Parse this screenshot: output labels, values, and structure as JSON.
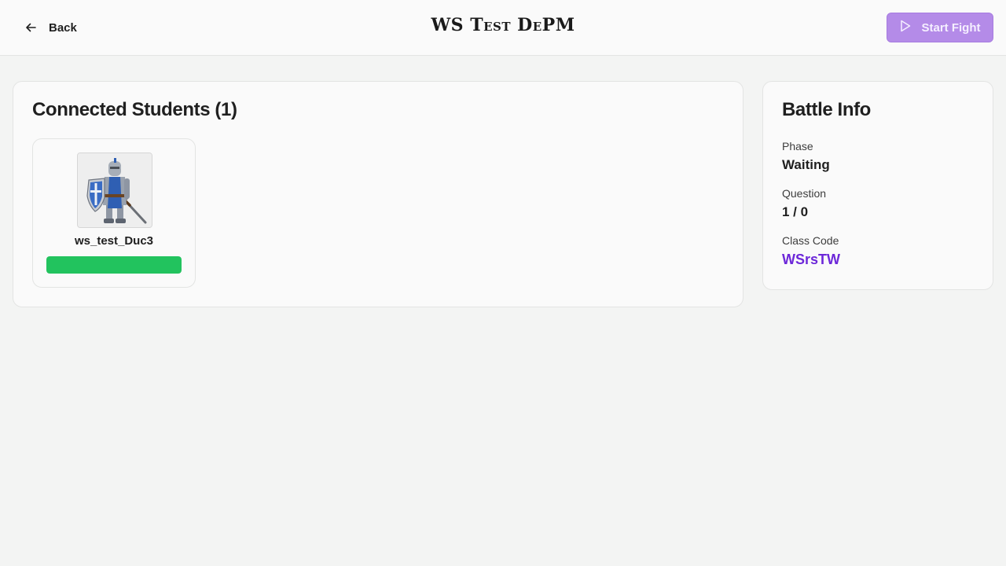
{
  "header": {
    "back_label": "Back",
    "title": "WS Test DePM",
    "start_label": "Start Fight"
  },
  "students": {
    "heading": "Connected Students (1)",
    "items": [
      {
        "name": "ws_test_Duc3",
        "hp_fraction": 1.0,
        "avatar": "knight-avatar"
      }
    ]
  },
  "battle_info": {
    "heading": "Battle Info",
    "phase_label": "Phase",
    "phase_value": "Waiting",
    "question_label": "Question",
    "question_value": "1 / 0",
    "class_code_label": "Class Code",
    "class_code_value": "WSrsTW"
  },
  "colors": {
    "accent": "#b48be8",
    "code": "#6d28d9",
    "hp": "#22c35e"
  }
}
